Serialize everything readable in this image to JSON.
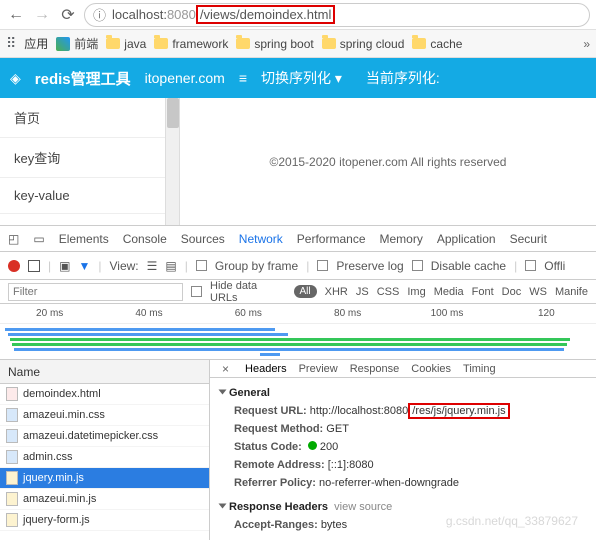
{
  "nav": {
    "host": "localhost:",
    "port": "8080",
    "path": "/views/demoindex.html"
  },
  "bookmarks": {
    "apps": "应用",
    "items": [
      "前端",
      "java",
      "framework",
      "spring boot",
      "spring cloud",
      "cache"
    ]
  },
  "header": {
    "brand": "redis管理工具",
    "site": "itopener.com",
    "switch": "切换序列化",
    "current": "当前序列化:"
  },
  "sidebar": {
    "items": [
      "首页",
      "key查询",
      "key-value"
    ]
  },
  "copyright": "©2015-2020 itopener.com All rights reserved",
  "devtabs": [
    "Elements",
    "Console",
    "Sources",
    "Network",
    "Performance",
    "Memory",
    "Application",
    "Securit"
  ],
  "toolbar": {
    "view": "View:",
    "group": "Group by frame",
    "preserve": "Preserve log",
    "disable": "Disable cache",
    "offline": "Offli"
  },
  "filter": {
    "ph": "Filter",
    "hide": "Hide data URLs",
    "all": "All",
    "types": [
      "XHR",
      "JS",
      "CSS",
      "Img",
      "Media",
      "Font",
      "Doc",
      "WS",
      "Manife"
    ]
  },
  "times": [
    "20 ms",
    "40 ms",
    "60 ms",
    "80 ms",
    "100 ms",
    "120"
  ],
  "files": {
    "hdr": "Name",
    "items": [
      {
        "n": "demoindex.html",
        "t": "html",
        "sel": false
      },
      {
        "n": "amazeui.min.css",
        "t": "css",
        "sel": false
      },
      {
        "n": "amazeui.datetimepicker.css",
        "t": "css",
        "sel": false
      },
      {
        "n": "admin.css",
        "t": "css",
        "sel": false
      },
      {
        "n": "jquery.min.js",
        "t": "js",
        "sel": true
      },
      {
        "n": "amazeui.min.js",
        "t": "js",
        "sel": false
      },
      {
        "n": "jquery-form.js",
        "t": "js",
        "sel": false
      }
    ]
  },
  "detail": {
    "tabs": [
      "Headers",
      "Preview",
      "Response",
      "Cookies",
      "Timing"
    ],
    "general": "General",
    "req_url_l": "Request URL:",
    "req_url_pre": "http://localhost:8080",
    "req_url_box": "/res/js/jquery.min.js",
    "method_l": "Request Method:",
    "method": "GET",
    "status_l": "Status Code:",
    "status": "200",
    "remote_l": "Remote Address:",
    "remote": "[::1]:8080",
    "ref_l": "Referrer Policy:",
    "ref": "no-referrer-when-downgrade",
    "resp": "Response Headers",
    "viewsrc": "view source",
    "accept_l": "Accept-Ranges:",
    "accept": "bytes"
  },
  "watermark": "g.csdn.net/qq_33879627"
}
